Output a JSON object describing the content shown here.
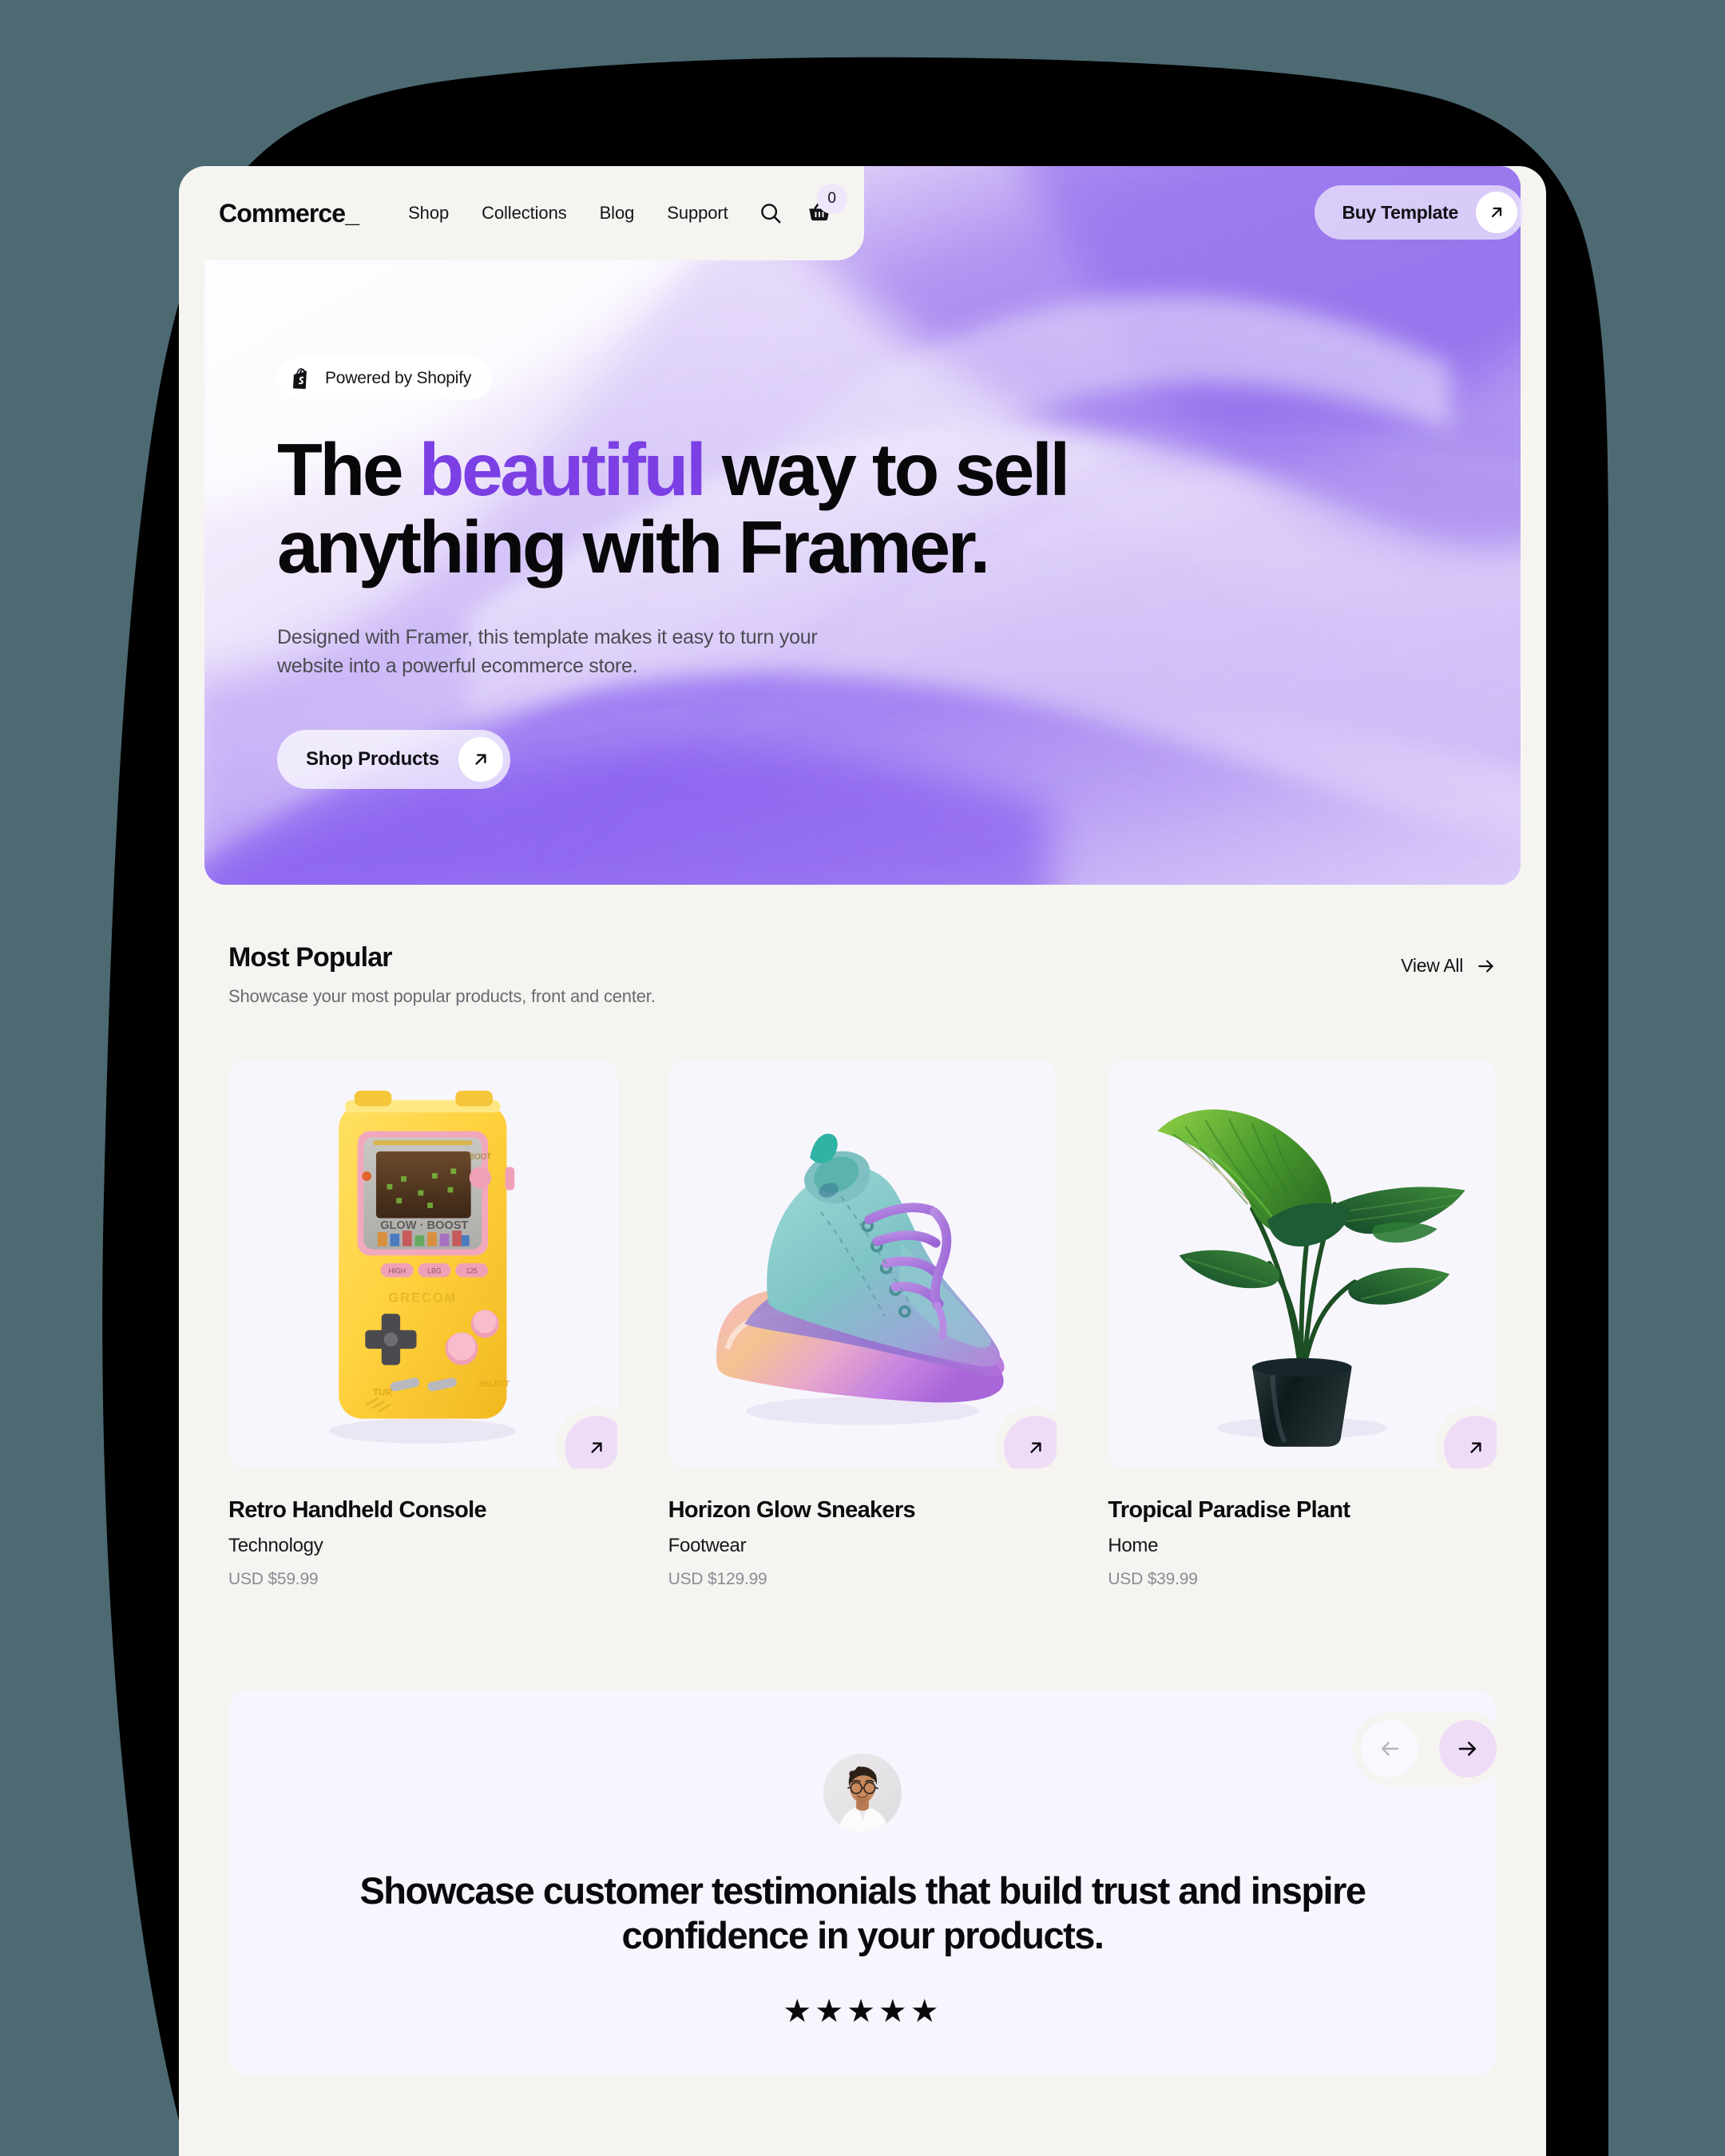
{
  "theme": {
    "backdrop": "#4d6a73",
    "device_bg": "#f6f4f1",
    "accent_purple": "#7b3fe4",
    "soft_purple": "#eedcf7",
    "card_bg": "#f8f6fd"
  },
  "nav": {
    "brand": "Commerce_",
    "links": [
      "Shop",
      "Collections",
      "Blog",
      "Support"
    ],
    "search_icon": "search-icon",
    "cart_icon": "shopping-basket-icon",
    "cart_count": "0",
    "buy_button": {
      "label": "Buy Template",
      "icon": "arrow-up-right-icon"
    }
  },
  "hero": {
    "badge": {
      "label": "Powered by Shopify",
      "icon": "shopify-bag-icon"
    },
    "headline_pre": "The ",
    "headline_accent": "beautiful",
    "headline_post": " way to sell anything with Framer.",
    "subtitle": "Designed with Framer, this template makes it easy to turn your website into a powerful ecommerce store.",
    "cta": {
      "label": "Shop Products",
      "icon": "arrow-up-right-icon"
    }
  },
  "popular": {
    "title": "Most Popular",
    "subtitle": "Showcase your most popular products, front and center.",
    "view_all": {
      "label": "View All",
      "icon": "arrow-right-icon"
    },
    "products": [
      {
        "name": "Retro Handheld Console",
        "category": "Technology",
        "price": "USD $59.99",
        "art": "retro-handheld-console",
        "action_icon": "arrow-up-right-icon"
      },
      {
        "name": "Horizon Glow Sneakers",
        "category": "Footwear",
        "price": "USD $129.99",
        "art": "horizon-glow-sneaker",
        "action_icon": "arrow-up-right-icon"
      },
      {
        "name": "Tropical Paradise Plant",
        "category": "Home",
        "price": "USD $39.99",
        "art": "tropical-paradise-plant",
        "action_icon": "arrow-up-right-icon"
      }
    ]
  },
  "testimonial": {
    "prev_icon": "arrow-left-icon",
    "next_icon": "arrow-right-icon",
    "avatar": "customer-avatar",
    "quote": "Showcase customer testimonials that build trust and inspire confidence in your products.",
    "rating": "★★★★★"
  }
}
